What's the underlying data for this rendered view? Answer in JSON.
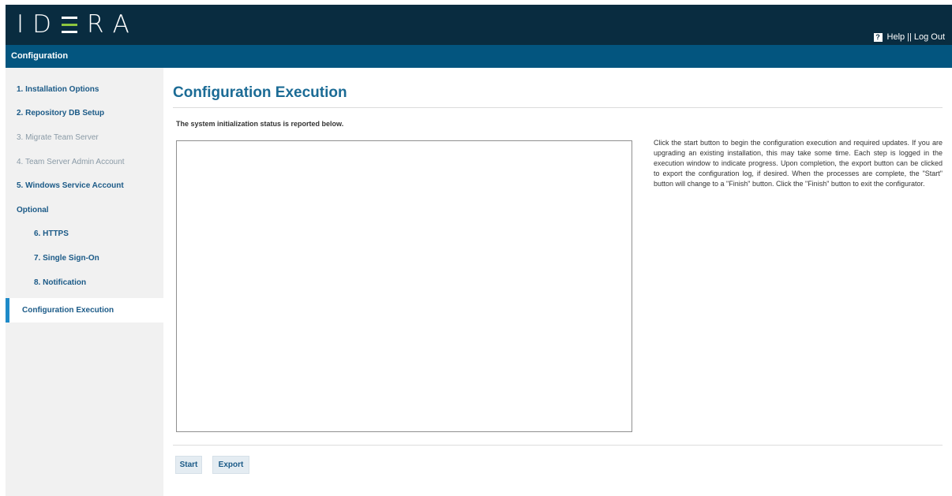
{
  "header": {
    "logo_text": "IDERA",
    "help_icon": "?",
    "help_label": "Help",
    "separator": "||",
    "logout_label": "Log Out"
  },
  "subbar": {
    "title": "Configuration"
  },
  "sidebar": {
    "items": [
      {
        "label": "1. Installation Options",
        "state": "enabled"
      },
      {
        "label": "2. Repository DB Setup",
        "state": "enabled"
      },
      {
        "label": "3. Migrate Team Server",
        "state": "disabled"
      },
      {
        "label": "4. Team Server Admin Account",
        "state": "disabled"
      },
      {
        "label": "5. Windows Service Account",
        "state": "enabled"
      },
      {
        "label": "Optional",
        "state": "heading"
      },
      {
        "label": "6. HTTPS",
        "state": "enabled"
      },
      {
        "label": "7. Single Sign-On",
        "state": "enabled"
      },
      {
        "label": "8. Notification",
        "state": "enabled"
      }
    ],
    "active_item": "Configuration Execution"
  },
  "main": {
    "title": "Configuration Execution",
    "status_text": "The system initialization status is reported below.",
    "description": "Click the start button to begin the configuration execution and required updates. If you are upgrading an existing installation, this may take some time. Each step is logged in the execution window to indicate progress. Upon completion, the export button can be clicked to export the configuration log, if desired. When the processes are complete, the \"Start\" button will change to a \"Finish\" button. Click the \"Finish\" button to exit the configurator.",
    "start_button": "Start",
    "export_button": "Export"
  },
  "colors": {
    "header_bg": "#092c40",
    "subbar_bg": "#03557f",
    "accent_green": "#8dc63f",
    "link_blue": "#1b5a87",
    "active_marker": "#1e8ac8"
  }
}
